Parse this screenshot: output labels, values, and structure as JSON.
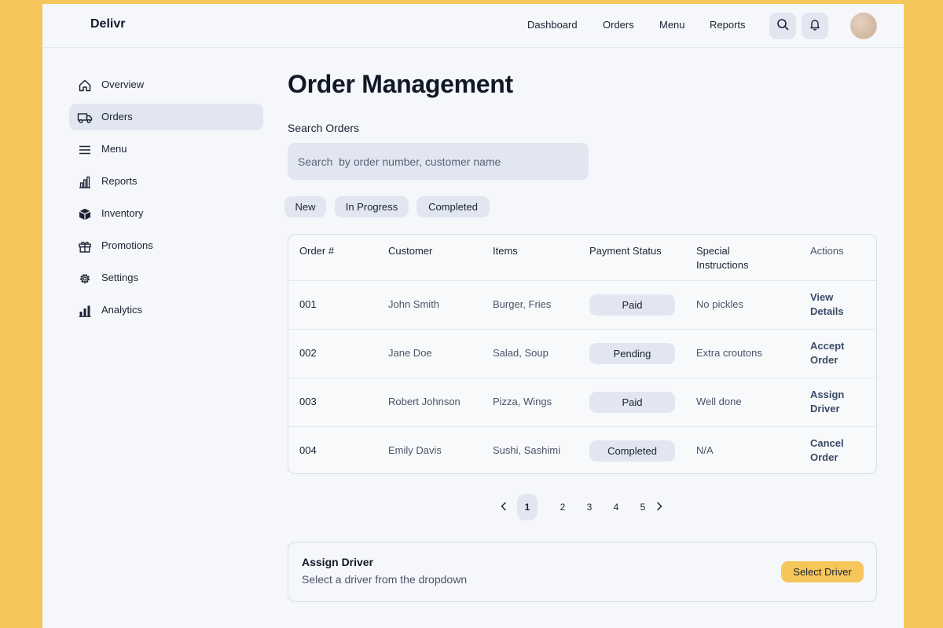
{
  "app": {
    "brand": "Delivr"
  },
  "topnav": [
    {
      "label": "Dashboard"
    },
    {
      "label": "Orders"
    },
    {
      "label": "Menu"
    },
    {
      "label": "Reports"
    }
  ],
  "sidebar": {
    "items": [
      {
        "label": "Overview",
        "icon": "home-icon"
      },
      {
        "label": "Orders",
        "icon": "truck-icon",
        "active": true
      },
      {
        "label": "Menu",
        "icon": "menu-icon"
      },
      {
        "label": "Reports",
        "icon": "bar-chart-icon"
      },
      {
        "label": "Inventory",
        "icon": "box-icon"
      },
      {
        "label": "Promotions",
        "icon": "gift-icon"
      },
      {
        "label": "Settings",
        "icon": "gear-icon"
      },
      {
        "label": "Analytics",
        "icon": "analytics-icon"
      }
    ]
  },
  "main": {
    "title": "Order Management",
    "search_label": "Search Orders",
    "search_placeholder": "Search  by order number, customer name",
    "filters": [
      "New",
      "In Progress",
      "Completed"
    ]
  },
  "table": {
    "headers": [
      "Order #",
      "Customer",
      "Items",
      "Payment Status",
      "Special Instructions",
      "Actions"
    ],
    "rows": [
      {
        "order": "001",
        "customer": "John Smith",
        "items": "Burger, Fries",
        "status": "Paid",
        "instructions": "No pickles",
        "action": "View Details"
      },
      {
        "order": "002",
        "customer": "Jane Doe",
        "items": "Salad, Soup",
        "status": "Pending",
        "instructions": "Extra croutons",
        "action": "Accept Order"
      },
      {
        "order": "003",
        "customer": "Robert Johnson",
        "items": "Pizza, Wings",
        "status": "Paid",
        "instructions": "Well done",
        "action": "Assign Driver"
      },
      {
        "order": "004",
        "customer": "Emily Davis",
        "items": "Sushi, Sashimi",
        "status": "Completed",
        "instructions": "N/A",
        "action": "Cancel Order"
      }
    ]
  },
  "pagination": {
    "pages": [
      "1",
      "2",
      "3",
      "4",
      "5"
    ],
    "current": "1"
  },
  "assign_card": {
    "title": "Assign Driver",
    "subtitle": "Select a driver from the dropdown",
    "button": "Select Driver"
  },
  "colors": {
    "background": "#f5c65a",
    "accent": "#f5c65a",
    "chip": "#e2e6f1"
  }
}
